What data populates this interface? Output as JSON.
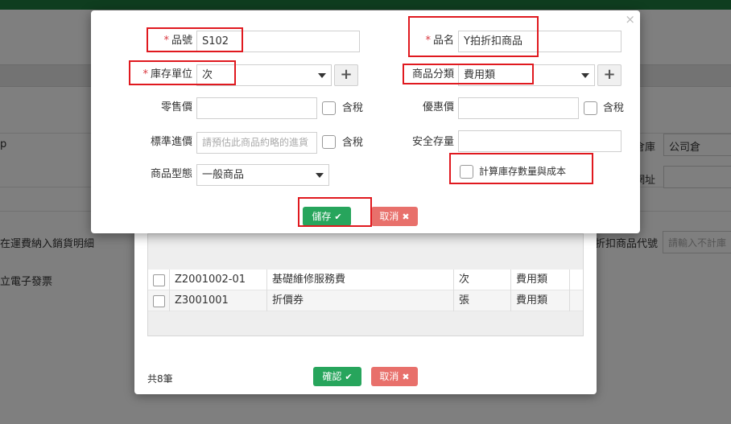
{
  "background": {
    "left_texts": [
      "p",
      "在運費納入銷貨明細",
      "立電子發票"
    ],
    "warehouse_label": "倉庫",
    "warehouse_value": "公司倉",
    "address_label": "網址",
    "discount_code_label": "折扣商品代號",
    "discount_code_placeholder": "請輸入不計庫"
  },
  "edit_modal": {
    "close_glyph": "×",
    "required_mark": "*",
    "product_no_label": "品號",
    "product_no_value": "S102",
    "product_name_label": "品名",
    "product_name_value": "Y拍折扣商品",
    "stock_unit_label": "庫存單位",
    "stock_unit_value": "次",
    "category_label": "商品分類",
    "category_value": "費用類",
    "plus_glyph": "+",
    "retail_price_label": "零售價",
    "retail_price_value": "",
    "tax_included_label": "含稅",
    "discount_price_label": "優惠價",
    "discount_price_value": "",
    "standard_cost_label": "標準進價",
    "standard_cost_placeholder": "請預估此商品約略的進貨",
    "safety_stock_label": "安全存量",
    "safety_stock_value": "",
    "product_type_label": "商品型態",
    "product_type_value": "一般商品",
    "calc_stock_label": "計算庫存數量與成本",
    "save_label": "儲存",
    "cancel_label": "取消",
    "check_glyph": "✔",
    "x_glyph": "✖"
  },
  "picker": {
    "rows": [
      {
        "code": "Z2001002-01",
        "name": "基礎維修服務費",
        "unit": "次",
        "category": "費用類"
      },
      {
        "code": "Z3001001",
        "name": "折價券",
        "unit": "張",
        "category": "費用類"
      }
    ],
    "count_text": "共8筆",
    "confirm_label": "確認",
    "cancel_label": "取消"
  }
}
